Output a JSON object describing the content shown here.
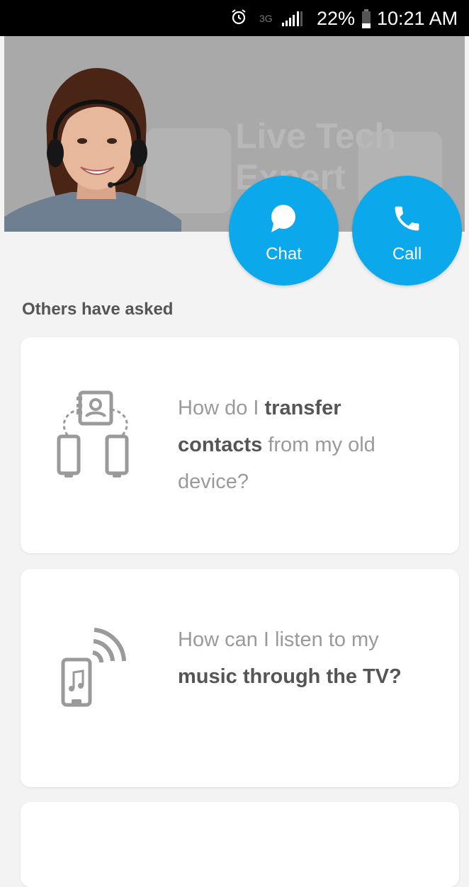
{
  "status_bar": {
    "network": "3G",
    "battery": "22%",
    "time": "10:21 AM"
  },
  "hero": {
    "background_text": "Live Tech Expert",
    "chat_label": "Chat",
    "call_label": "Call"
  },
  "section": {
    "title": "Others have asked"
  },
  "cards": [
    {
      "icon": "transfer-contacts-icon",
      "parts": [
        "How do I ",
        "transfer contacts",
        " from my old device?"
      ]
    },
    {
      "icon": "music-tv-icon",
      "parts": [
        "How can I listen to my ",
        "music through the TV?",
        ""
      ]
    }
  ],
  "colors": {
    "accent": "#0ba9ec",
    "hero_bg": "#a9a9a9",
    "page_bg": "#f3f3f3"
  }
}
